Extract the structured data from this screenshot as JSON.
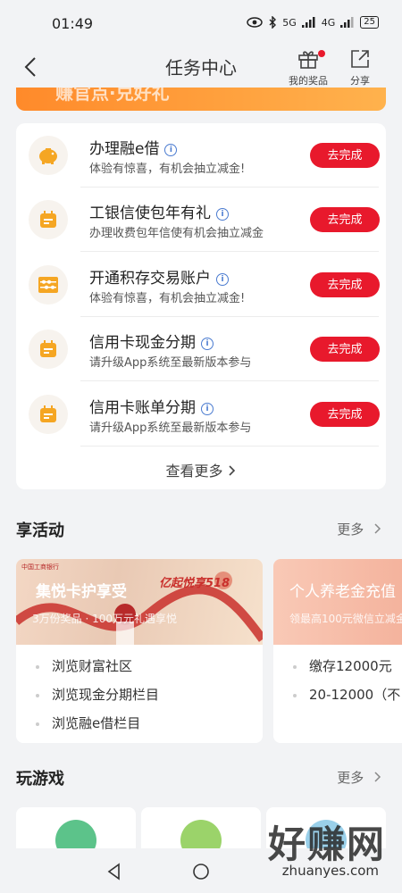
{
  "status_bar": {
    "time": "01:49",
    "network": "5G",
    "network2": "4G",
    "battery": "25"
  },
  "header": {
    "title": "任务中心",
    "prizes_label": "我的奖品",
    "share_label": "分享"
  },
  "banner": {
    "text": "赚官点·兑好礼"
  },
  "tasks": [
    {
      "title": "办理融e借",
      "desc": "体验有惊喜，有机会抽立减金!",
      "button": "去完成",
      "icon": "piggy-bank-icon"
    },
    {
      "title": "工银信使包年有礼",
      "desc": "办理收费包年信使有机会抽立减金",
      "button": "去完成",
      "icon": "calendar-icon"
    },
    {
      "title": "开通积存交易账户",
      "desc": "体验有惊喜，有机会抽立减金!",
      "button": "去完成",
      "icon": "abacus-icon"
    },
    {
      "title": "信用卡现金分期",
      "desc": "请升级App系统至最新版本参与",
      "button": "去完成",
      "icon": "calendar-icon"
    },
    {
      "title": "信用卡账单分期",
      "desc": "请升级App系统至最新版本参与",
      "button": "去完成",
      "icon": "calendar-icon"
    }
  ],
  "tasks_more": "查看更多",
  "activities": {
    "heading": "享活动",
    "more": "更多",
    "cards": [
      {
        "banner_title": "集悦卡护享受",
        "banner_sub": "3万份奖品 · 100万元礼遇享悦",
        "bank": "中国工商银行",
        "promo": "亿起悦享518",
        "items": [
          "浏览财富社区",
          "浏览现金分期栏目",
          "浏览融e借栏目"
        ]
      },
      {
        "banner_title": "个人养老金充值",
        "banner_sub": "领最高100元微信立减金",
        "items": [
          "缴存12000元",
          "20-12000（不"
        ]
      }
    ]
  },
  "games": {
    "heading": "玩游戏",
    "more": "更多"
  },
  "watermark": {
    "text": "好赚网",
    "url": "zhuanyes.com"
  },
  "colors": {
    "accent": "#e8192c",
    "orange": "#f5a623",
    "info_blue": "#4a7bd0"
  }
}
